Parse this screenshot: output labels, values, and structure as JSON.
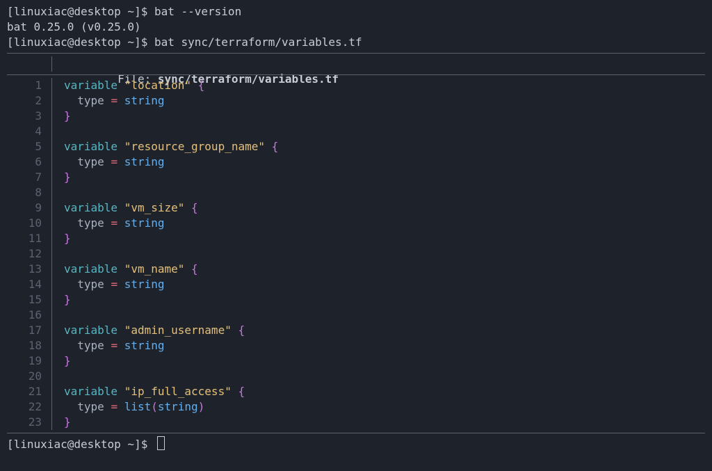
{
  "prompt": {
    "user": "linuxiac",
    "host": "desktop",
    "path": "~",
    "ps1_open": "[",
    "ps1_close": "]$ ",
    "at": "@",
    "space": " "
  },
  "cmd1": "bat --version",
  "version_output": "bat 0.25.0 (v0.25.0)",
  "cmd2": "bat sync/terraform/variables.tf",
  "file_label": "File: ",
  "file_path": "sync/terraform/variables.tf",
  "code": {
    "lines": [
      {
        "n": "1",
        "tokens": [
          {
            "t": "variable ",
            "c": "kw"
          },
          {
            "t": "\"location\"",
            "c": "str"
          },
          {
            "t": " {",
            "c": "brace"
          }
        ]
      },
      {
        "n": "2",
        "tokens": [
          {
            "t": "  type ",
            "c": "attr"
          },
          {
            "t": "=",
            "c": "eq"
          },
          {
            "t": " string",
            "c": "type"
          }
        ]
      },
      {
        "n": "3",
        "tokens": [
          {
            "t": "}",
            "c": "brace"
          }
        ]
      },
      {
        "n": "4",
        "tokens": []
      },
      {
        "n": "5",
        "tokens": [
          {
            "t": "variable ",
            "c": "kw"
          },
          {
            "t": "\"resource_group_name\"",
            "c": "str"
          },
          {
            "t": " {",
            "c": "brace"
          }
        ]
      },
      {
        "n": "6",
        "tokens": [
          {
            "t": "  type ",
            "c": "attr"
          },
          {
            "t": "=",
            "c": "eq"
          },
          {
            "t": " string",
            "c": "type"
          }
        ]
      },
      {
        "n": "7",
        "tokens": [
          {
            "t": "}",
            "c": "brace"
          }
        ]
      },
      {
        "n": "8",
        "tokens": []
      },
      {
        "n": "9",
        "tokens": [
          {
            "t": "variable ",
            "c": "kw"
          },
          {
            "t": "\"vm_size\"",
            "c": "str"
          },
          {
            "t": " {",
            "c": "brace"
          }
        ]
      },
      {
        "n": "10",
        "tokens": [
          {
            "t": "  type ",
            "c": "attr"
          },
          {
            "t": "=",
            "c": "eq"
          },
          {
            "t": " string",
            "c": "type"
          }
        ]
      },
      {
        "n": "11",
        "tokens": [
          {
            "t": "}",
            "c": "brace"
          }
        ]
      },
      {
        "n": "12",
        "tokens": []
      },
      {
        "n": "13",
        "tokens": [
          {
            "t": "variable ",
            "c": "kw"
          },
          {
            "t": "\"vm_name\"",
            "c": "str"
          },
          {
            "t": " {",
            "c": "brace"
          }
        ]
      },
      {
        "n": "14",
        "tokens": [
          {
            "t": "  type ",
            "c": "attr"
          },
          {
            "t": "=",
            "c": "eq"
          },
          {
            "t": " string",
            "c": "type"
          }
        ]
      },
      {
        "n": "15",
        "tokens": [
          {
            "t": "}",
            "c": "brace"
          }
        ]
      },
      {
        "n": "16",
        "tokens": []
      },
      {
        "n": "17",
        "tokens": [
          {
            "t": "variable ",
            "c": "kw"
          },
          {
            "t": "\"admin_username\"",
            "c": "str"
          },
          {
            "t": " {",
            "c": "brace"
          }
        ]
      },
      {
        "n": "18",
        "tokens": [
          {
            "t": "  type ",
            "c": "attr"
          },
          {
            "t": "=",
            "c": "eq"
          },
          {
            "t": " string",
            "c": "type"
          }
        ]
      },
      {
        "n": "19",
        "tokens": [
          {
            "t": "}",
            "c": "brace"
          }
        ]
      },
      {
        "n": "20",
        "tokens": []
      },
      {
        "n": "21",
        "tokens": [
          {
            "t": "variable ",
            "c": "kw"
          },
          {
            "t": "\"ip_full_access\"",
            "c": "str"
          },
          {
            "t": " {",
            "c": "brace"
          }
        ]
      },
      {
        "n": "22",
        "tokens": [
          {
            "t": "  type ",
            "c": "attr"
          },
          {
            "t": "=",
            "c": "eq"
          },
          {
            "t": " ",
            "c": "attr"
          },
          {
            "t": "list",
            "c": "func"
          },
          {
            "t": "(",
            "c": "paren"
          },
          {
            "t": "string",
            "c": "type"
          },
          {
            "t": ")",
            "c": "paren"
          }
        ]
      },
      {
        "n": "23",
        "tokens": [
          {
            "t": "}",
            "c": "brace"
          }
        ]
      }
    ]
  }
}
